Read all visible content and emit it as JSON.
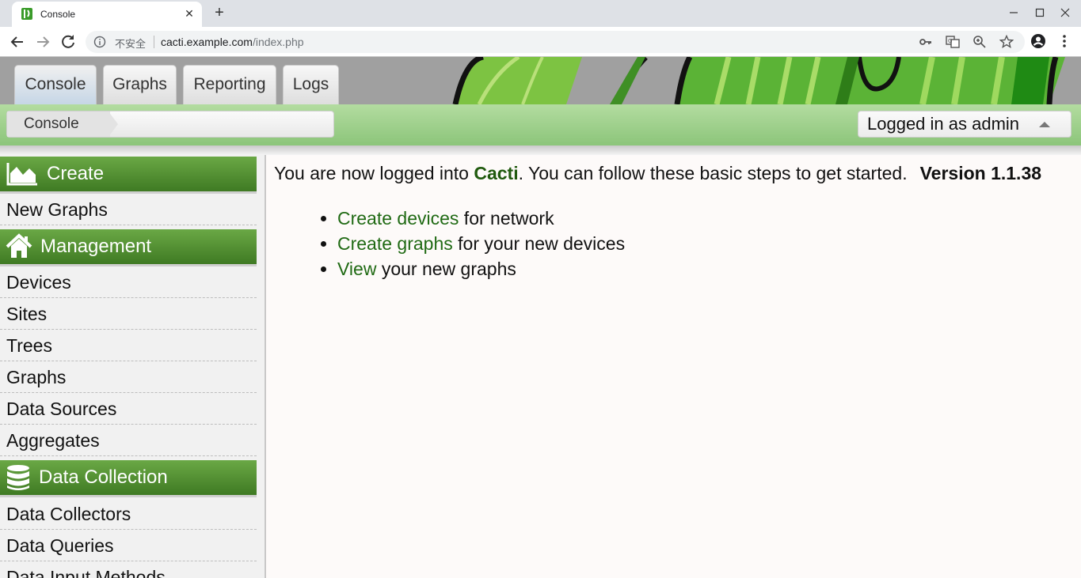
{
  "browser": {
    "tab_title": "Console",
    "close_glyph": "✕",
    "newtab_glyph": "+",
    "insecure_label": "不安全",
    "url_host": "cacti.example.com",
    "url_path": "/index.php",
    "icons": [
      "back-arrow-icon",
      "forward-arrow-icon",
      "reload-icon",
      "info-icon",
      "key-icon",
      "translate-icon",
      "zoom-icon",
      "star-icon",
      "account-icon",
      "menu-icon"
    ]
  },
  "header": {
    "tabs": [
      {
        "label": "Console",
        "active": true
      },
      {
        "label": "Graphs",
        "active": false
      },
      {
        "label": "Reporting",
        "active": false
      },
      {
        "label": "Logs",
        "active": false
      }
    ],
    "breadcrumb": "Console",
    "user_label": "Logged in as admin"
  },
  "sidebar": {
    "create": {
      "label": "Create",
      "icon": "area-chart-icon",
      "items": [
        "New Graphs"
      ]
    },
    "management": {
      "label": "Management",
      "icon": "home-icon",
      "items": [
        "Devices",
        "Sites",
        "Trees",
        "Graphs",
        "Data Sources",
        "Aggregates"
      ]
    },
    "data_collection": {
      "label": "Data Collection",
      "icon": "database-icon",
      "items": [
        "Data Collectors",
        "Data Queries",
        "Data Input Methods"
      ]
    }
  },
  "main": {
    "intro_prefix": "You are now logged into ",
    "intro_brand": "Cacti",
    "intro_suffix": ". You can follow these basic steps to get started.",
    "version": "Version 1.1.38",
    "steps": [
      {
        "link": "Create devices",
        "text": " for network"
      },
      {
        "link": "Create graphs",
        "text": " for your new devices"
      },
      {
        "link": "View",
        "text": " your new graphs"
      }
    ]
  },
  "colors": {
    "accent_green": "#3f7a23",
    "link_green": "#206a14",
    "brand_green": "#205a0e"
  }
}
